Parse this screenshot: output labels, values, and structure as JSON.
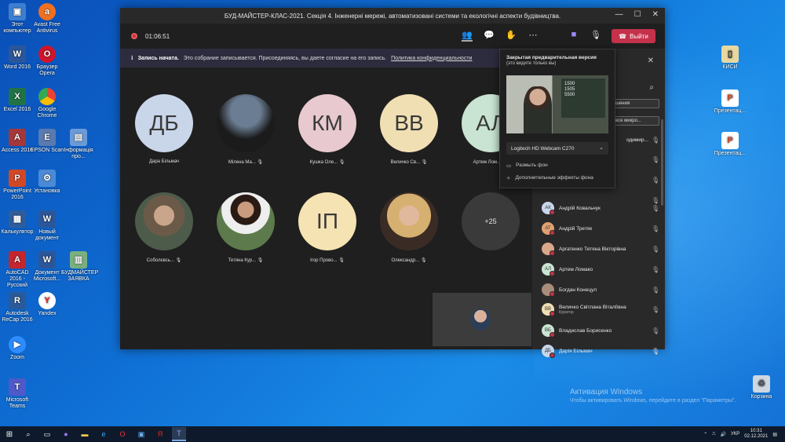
{
  "window": {
    "title": "БУД-МАЙСТЕР-КЛАС-2021. Секція 4. Інженерні мережі, автоматизовані системи та екологічні аспекти будівництва.",
    "timer": "01:06:51",
    "leave_label": "Выйти",
    "toolbar_icons": [
      "people-icon",
      "chat-icon",
      "reactions-icon",
      "more-icon",
      "camera-icon",
      "mic-icon",
      "share-icon"
    ]
  },
  "banner": {
    "bold": "Запись начата.",
    "text": "Это собрание записывается. Присоединяясь, вы даете согласие на его запись.",
    "link": "Политика конфиденциальности"
  },
  "tiles": [
    {
      "initials": "ДБ",
      "name": "Дара Більмач",
      "color": "#c9d6ea"
    },
    {
      "initials": "",
      "name": "Мілена Ма...",
      "color": "#1a1a1a"
    },
    {
      "initials": "КМ",
      "name": "Кушка Оле...",
      "color": "#e8c9cf"
    },
    {
      "initials": "ВВ",
      "name": "Величко Св...",
      "color": "#f0dfb3"
    },
    {
      "initials": "АЛ",
      "name": "Артем Лом...",
      "color": "#c9e4d2"
    },
    {
      "initials": "",
      "name": "Соболєвсь...",
      "color": "#5a6b55"
    },
    {
      "initials": "",
      "name": "Тетяна Кур...",
      "color": "#4d6a44"
    },
    {
      "initials": "ІП",
      "name": "Ігор Прово...",
      "color": "#f5e3b3"
    },
    {
      "initials": "",
      "name": "Олександр...",
      "color": "#8a6b52"
    },
    {
      "initials": "+25",
      "name": "",
      "color": "#3a3a3a"
    }
  ],
  "popup": {
    "title": "Закрытая предварительная версия",
    "subtitle": "(это видите только вы)",
    "board_text": "1500\n1505\n5500",
    "camera": "Logitech HD Webcam C270",
    "blur": "Размыть фон",
    "effects": "Дополнительные эффекты фона"
  },
  "panel": {
    "invite_label": "шашения",
    "mute_label": "все микро...",
    "participants": [
      {
        "initials": "",
        "name": "одимир...",
        "sub": "",
        "color": "#8aa"
      },
      {
        "initials": "",
        "name": "",
        "sub": "",
        "color": "#8aa"
      },
      {
        "initials": "",
        "name": "",
        "sub": "",
        "color": "#8aa"
      },
      {
        "initials": "",
        "name": "",
        "sub": "",
        "color": "#8aa"
      },
      {
        "initials": "АК",
        "name": "Андрій Ковальчук",
        "sub": "",
        "color": "#c9d6ea"
      },
      {
        "initials": "АТ",
        "name": "Андрій Третяк",
        "sub": "",
        "color": "#e0a070"
      },
      {
        "initials": "",
        "name": "Аргатенко Тетяна Вікторівна",
        "sub": "",
        "color": "#d9a88a"
      },
      {
        "initials": "АЛ",
        "name": "Артем Ломако",
        "sub": "",
        "color": "#c9e4d2"
      },
      {
        "initials": "",
        "name": "Богдан Конецул",
        "sub": "",
        "color": "#a98c7a"
      },
      {
        "initials": "ВВ",
        "name": "Величко Світлана Віталіївна",
        "sub": "Куратор",
        "color": "#f0dfb3"
      },
      {
        "initials": "ВБ",
        "name": "Владислав Борисенко",
        "sub": "",
        "color": "#c9e4d2"
      },
      {
        "initials": "ДБ",
        "name": "Дарія Більмач",
        "sub": "",
        "color": "#c9d6ea"
      }
    ]
  },
  "desktop_icons": [
    {
      "label": "Этот компьютер",
      "color": "#3c7fd1",
      "glyph": "▣"
    },
    {
      "label": "Avast Free Antivirus",
      "color": "#f07020",
      "glyph": "a"
    },
    {
      "label": "Word 2016",
      "color": "#2b579a",
      "glyph": "W"
    },
    {
      "label": "Браузер Opera",
      "color": "#d0142c",
      "glyph": "O"
    },
    {
      "label": "Excel 2016",
      "color": "#217346",
      "glyph": "X"
    },
    {
      "label": "Google Chrome",
      "color": "#34a853",
      "glyph": "●"
    },
    {
      "label": "Access 2016",
      "color": "#a4373a",
      "glyph": "A"
    },
    {
      "label": "EPSON Scan",
      "color": "#5a7ab0",
      "glyph": "E"
    },
    {
      "label": "PowerPoint 2016",
      "color": "#d24726",
      "glyph": "P"
    },
    {
      "label": "Установка",
      "color": "#4b8bd6",
      "glyph": "⚙"
    },
    {
      "label": "Калькулятор",
      "color": "#2f5c9b",
      "glyph": "▦"
    },
    {
      "label": "Новый документ",
      "color": "#2b579a",
      "glyph": "W"
    },
    {
      "label": "AutoCAD 2016 - Русский",
      "color": "#c4262e",
      "glyph": "A"
    },
    {
      "label": "Документ Microsoft...",
      "color": "#2b579a",
      "glyph": "W"
    },
    {
      "label": "Autodesk ReCap 2016",
      "color": "#2a5a9a",
      "glyph": "R"
    },
    {
      "label": "Yandex",
      "color": "#ffffff",
      "glyph": "Y"
    },
    {
      "label": "Zoom",
      "color": "#2d8cff",
      "glyph": "▶"
    },
    {
      "label": "Microsoft Teams",
      "color": "#5059c9",
      "glyph": "T"
    },
    {
      "label": "Інформація про...",
      "color": "#6a9bd8",
      "glyph": "▤"
    },
    {
      "label": "БУДМАЙСТЕР ЗАЯВКА",
      "color": "#7ab080",
      "glyph": "▥"
    },
    {
      "label": "КИСИ",
      "color": "#e8d8a0",
      "glyph": "▯"
    },
    {
      "label": "Презентац...",
      "color": "#d24726",
      "glyph": "P"
    },
    {
      "label": "Презентац...",
      "color": "#d24726",
      "glyph": "P"
    },
    {
      "label": "Корзина",
      "color": "#cfd8e0",
      "glyph": "🗑"
    }
  ],
  "watermark": {
    "line1": "Активация Windows",
    "line2": "Чтобы активировать Windows, перейдите в раздел \"Параметры\"."
  },
  "taskbar": {
    "lang": "УКР",
    "time": "10:31",
    "date": "02.12.2021"
  }
}
